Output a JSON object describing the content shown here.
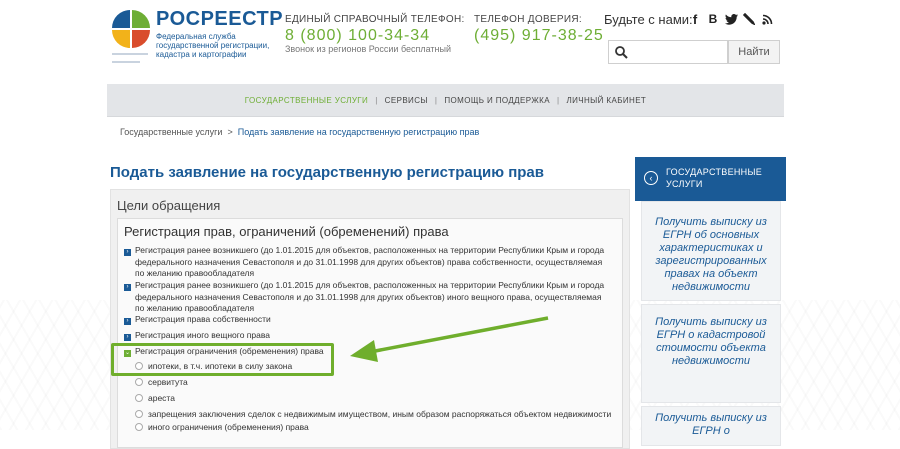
{
  "header": {
    "brand": "РОСРЕЕСТР",
    "brand_sub": "Федеральная служба государственной регистрации, кадастра и картографии",
    "hotline": {
      "title": "ЕДИНЫЙ СПРАВОЧНЫЙ ТЕЛЕФОН:",
      "phone": "8 (800) 100-34-34",
      "note": "Звонок из регионов России бесплатный"
    },
    "trust": {
      "title": "ТЕЛЕФОН ДОВЕРИЯ:",
      "phone": "(495) 917-38-25"
    },
    "social_label": "Будьте с нами:",
    "search": {
      "placeholder": "",
      "button": "Найти"
    }
  },
  "nav": [
    "ГОСУДАРСТВЕННЫЕ УСЛУГИ",
    "СЕРВИСЫ",
    "ПОМОЩЬ И ПОДДЕРЖКА",
    "ЛИЧНЫЙ КАБИНЕТ"
  ],
  "breadcrumb": {
    "home": "Государственные услуги",
    "sep": ">",
    "current": "Подать заявление на государственную регистрацию прав"
  },
  "page_title": "Подать заявление на государственную регистрацию прав",
  "panel": {
    "title": "Цели обращения",
    "section_title": "Регистрация прав, ограничений (обременений) права",
    "items": [
      "Регистрация ранее возникшего (до 1.01.2015 для объектов, расположенных на территории Республики Крым и города федерального назначения Севастополя и до 31.01.1998 для других объектов) права собственности, осуществляемая по желанию правообладателя",
      "Регистрация ранее возникшего (до 1.01.2015 для объектов, расположенных на территории Республики Крым и города федерального назначения Севастополя и до 31.01.1998 для других объектов) иного вещного права, осуществляемая по желанию правообладателя",
      "Регистрация права собственности",
      "Регистрация иного вещного права",
      "Регистрация ограничения (обременения) права"
    ],
    "sub_options": [
      "ипотеки, в т.ч. ипотеки в силу закона",
      "сервитута",
      "ареста",
      "запрещения заключения сделок с недвижимым имуществом, иным образом распоряжаться объектом недвижимости",
      "иного ограничения (обременения) права"
    ]
  },
  "sidebar": {
    "header": "ГОСУДАРСТВЕННЫЕ УСЛУГИ",
    "links": [
      "Получить выписку из ЕГРН об основных характеристиках и зарегистрированных правах на объект недвижимости",
      "Получить выписку из ЕГРН о кадастровой стоимости объекта недвижимости",
      "Получить выписку из ЕГРН о"
    ]
  },
  "colors": {
    "brand": "#1a5a96",
    "accent": "#6eae35",
    "highlight": "#6fae2c"
  }
}
